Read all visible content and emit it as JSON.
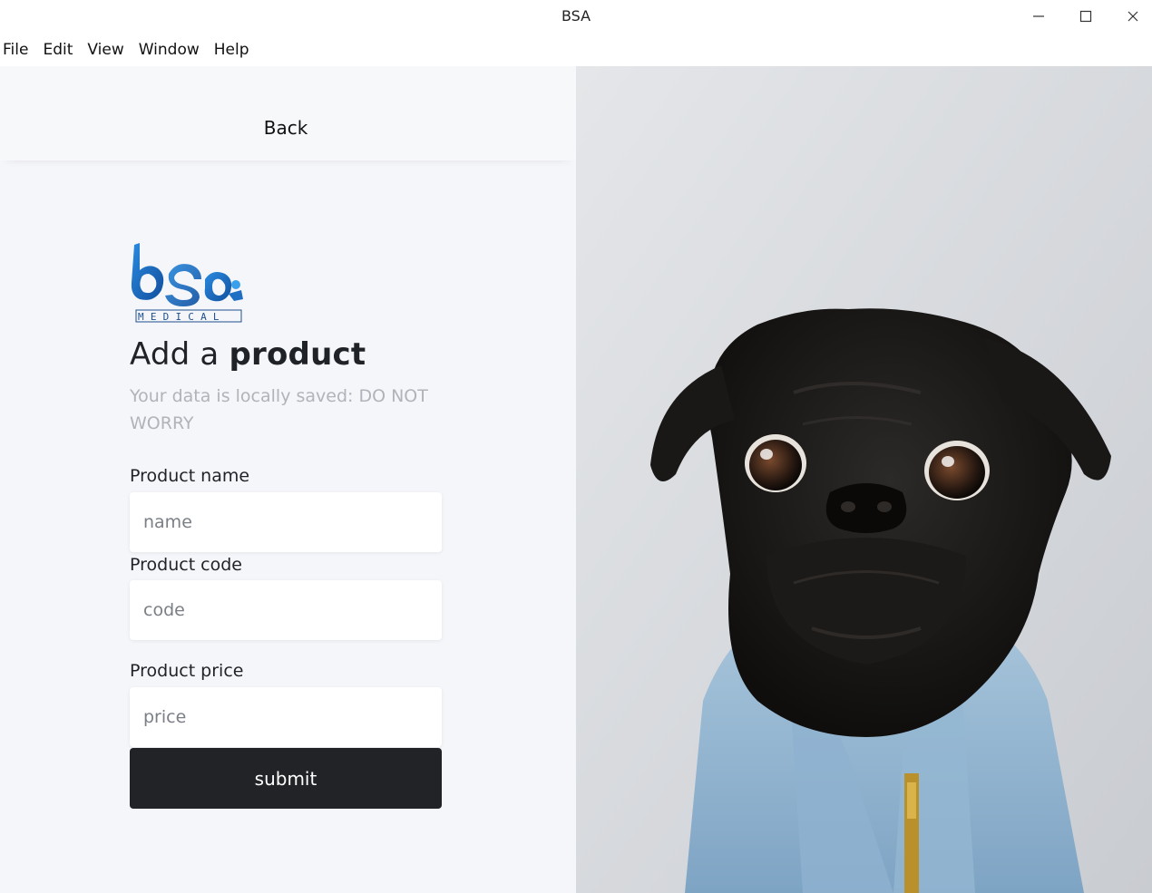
{
  "window": {
    "title": "BSA",
    "controls": [
      "minimize-icon",
      "maximize-icon",
      "close-icon"
    ]
  },
  "menu": {
    "file": "File",
    "edit": "Edit",
    "view": "View",
    "window": "Window",
    "help": "Help"
  },
  "nav": {
    "back_label": "Back"
  },
  "logo": {
    "text": "MEDICAL",
    "brand": "bsa"
  },
  "form": {
    "heading_prefix": "Add a ",
    "heading_bold": "product",
    "subtitle": "Your data is locally saved: DO NOT WORRY",
    "name_label": "Product name",
    "name_placeholder": "name",
    "code_label": "Product code",
    "code_placeholder": "code",
    "price_label": "Product price",
    "price_placeholder": "price",
    "submit_label": "submit"
  },
  "colors": {
    "panel_bg": "#f5f6fa",
    "button_bg": "#212327",
    "subtitle_text": "#b0b3b9",
    "logo_blue": "#1e73c9"
  },
  "photo": {
    "subject": "pug-in-denim-jacket"
  }
}
